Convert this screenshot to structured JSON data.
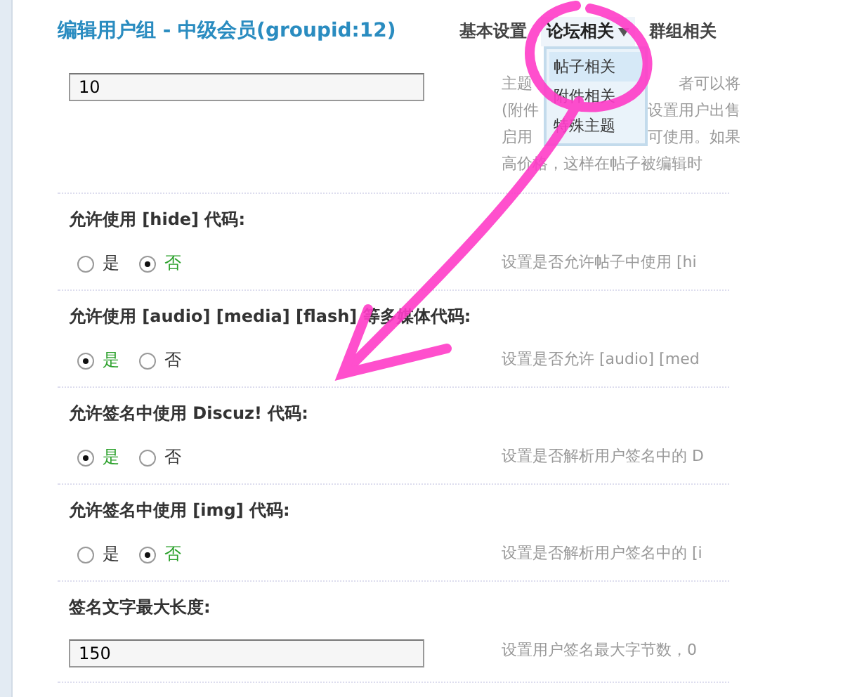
{
  "header": {
    "title": "编辑用户组 - 中级会员(groupid:12)",
    "tabs": [
      {
        "label": "基本设置",
        "selected": false,
        "caret": false
      },
      {
        "label": "论坛相关",
        "selected": true,
        "caret": true
      },
      {
        "label": "群组相关",
        "selected": false,
        "caret": false
      }
    ]
  },
  "dropdown": [
    {
      "label": "帖子相关",
      "selected": true
    },
    {
      "label": "附件相关",
      "selected": false
    },
    {
      "label": "特殊主题",
      "selected": false
    }
  ],
  "rows": [
    {
      "kind": "input",
      "value": "10",
      "description": [
        "主题",
        "(附件",
        "启用",
        "高价格，这样在帖子被编辑时"
      ],
      "description_right": [
        "者可以将",
        "设置用户出售",
        "可使用。如果"
      ]
    },
    {
      "kind": "radio",
      "label": "允许使用 [hide] 代码:",
      "options": [
        {
          "label": "是",
          "selected": false
        },
        {
          "label": "否",
          "selected": true
        }
      ],
      "description": [
        "设置是否允许帖子中使用 [hi"
      ]
    },
    {
      "kind": "radio",
      "label": "允许使用 [audio] [media] [flash] 等多媒体代码:",
      "options": [
        {
          "label": "是",
          "selected": true
        },
        {
          "label": "否",
          "selected": false
        }
      ],
      "description": [
        "设置是否允许 [audio] [med"
      ]
    },
    {
      "kind": "radio",
      "label": "允许签名中使用 Discuz! 代码:",
      "options": [
        {
          "label": "是",
          "selected": true
        },
        {
          "label": "否",
          "selected": false
        }
      ],
      "description": [
        "设置是否解析用户签名中的 D"
      ]
    },
    {
      "kind": "radio",
      "label": "允许签名中使用 [img] 代码:",
      "options": [
        {
          "label": "是",
          "selected": false
        },
        {
          "label": "否",
          "selected": true
        }
      ],
      "description": [
        "设置是否解析用户签名中的 [i"
      ]
    },
    {
      "kind": "input",
      "label": "签名文字最大长度:",
      "value": "150",
      "description": [
        "设置用户签名最大字节数，0"
      ]
    }
  ]
}
